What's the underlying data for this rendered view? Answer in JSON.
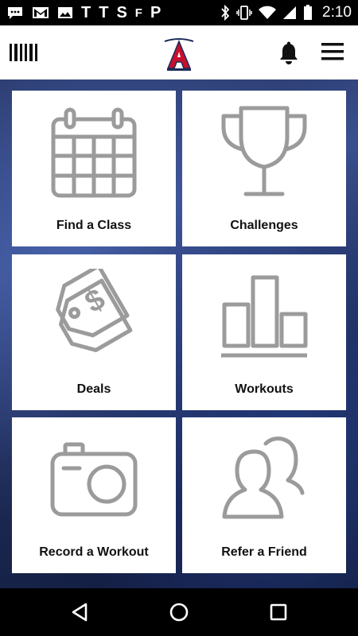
{
  "status_bar": {
    "left_icons": [
      "messages-icon",
      "gmail-icon",
      "image-icon",
      "T",
      "T",
      "S",
      "F",
      "P"
    ],
    "time": "2:10"
  },
  "header": {
    "logo_icon": "gym-logo-icon",
    "barcode_icon": "barcode-icon",
    "bell_icon": "bell-icon",
    "menu_icon": "hamburger-menu-icon"
  },
  "tiles": [
    {
      "label": "Find a Class",
      "icon": "calendar-icon"
    },
    {
      "label": "Challenges",
      "icon": "trophy-icon"
    },
    {
      "label": "Deals",
      "icon": "price-tag-icon"
    },
    {
      "label": "Workouts",
      "icon": "bar-chart-icon"
    },
    {
      "label": "Record a Workout",
      "icon": "camera-icon"
    },
    {
      "label": "Refer a Friend",
      "icon": "users-icon"
    }
  ],
  "nav": {
    "back_icon": "back-triangle-icon",
    "home_icon": "home-circle-icon",
    "recents_icon": "recents-square-icon"
  },
  "colors": {
    "icon_gray": "#9b9b9b",
    "tile_bg": "#ffffff",
    "logo_red": "#c8102e",
    "logo_navy": "#1c2b5a"
  }
}
